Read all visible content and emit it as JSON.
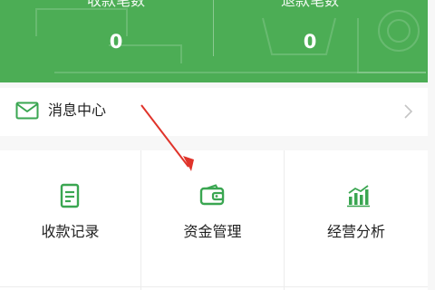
{
  "stats": {
    "left": {
      "label": "收款笔数",
      "value": "0"
    },
    "right": {
      "label": "退款笔数",
      "value": "0"
    }
  },
  "message_center": {
    "label": "消息中心",
    "icon": "envelope-icon"
  },
  "functions": [
    {
      "label": "收款记录",
      "icon": "receipt-icon"
    },
    {
      "label": "资金管理",
      "icon": "wallet-icon"
    },
    {
      "label": "经营分析",
      "icon": "bar-chart-icon"
    }
  ],
  "colors": {
    "header_green": "#4cad55",
    "icon_green": "#3aa651",
    "annotation_red": "#e0332a",
    "text": "#222222"
  }
}
